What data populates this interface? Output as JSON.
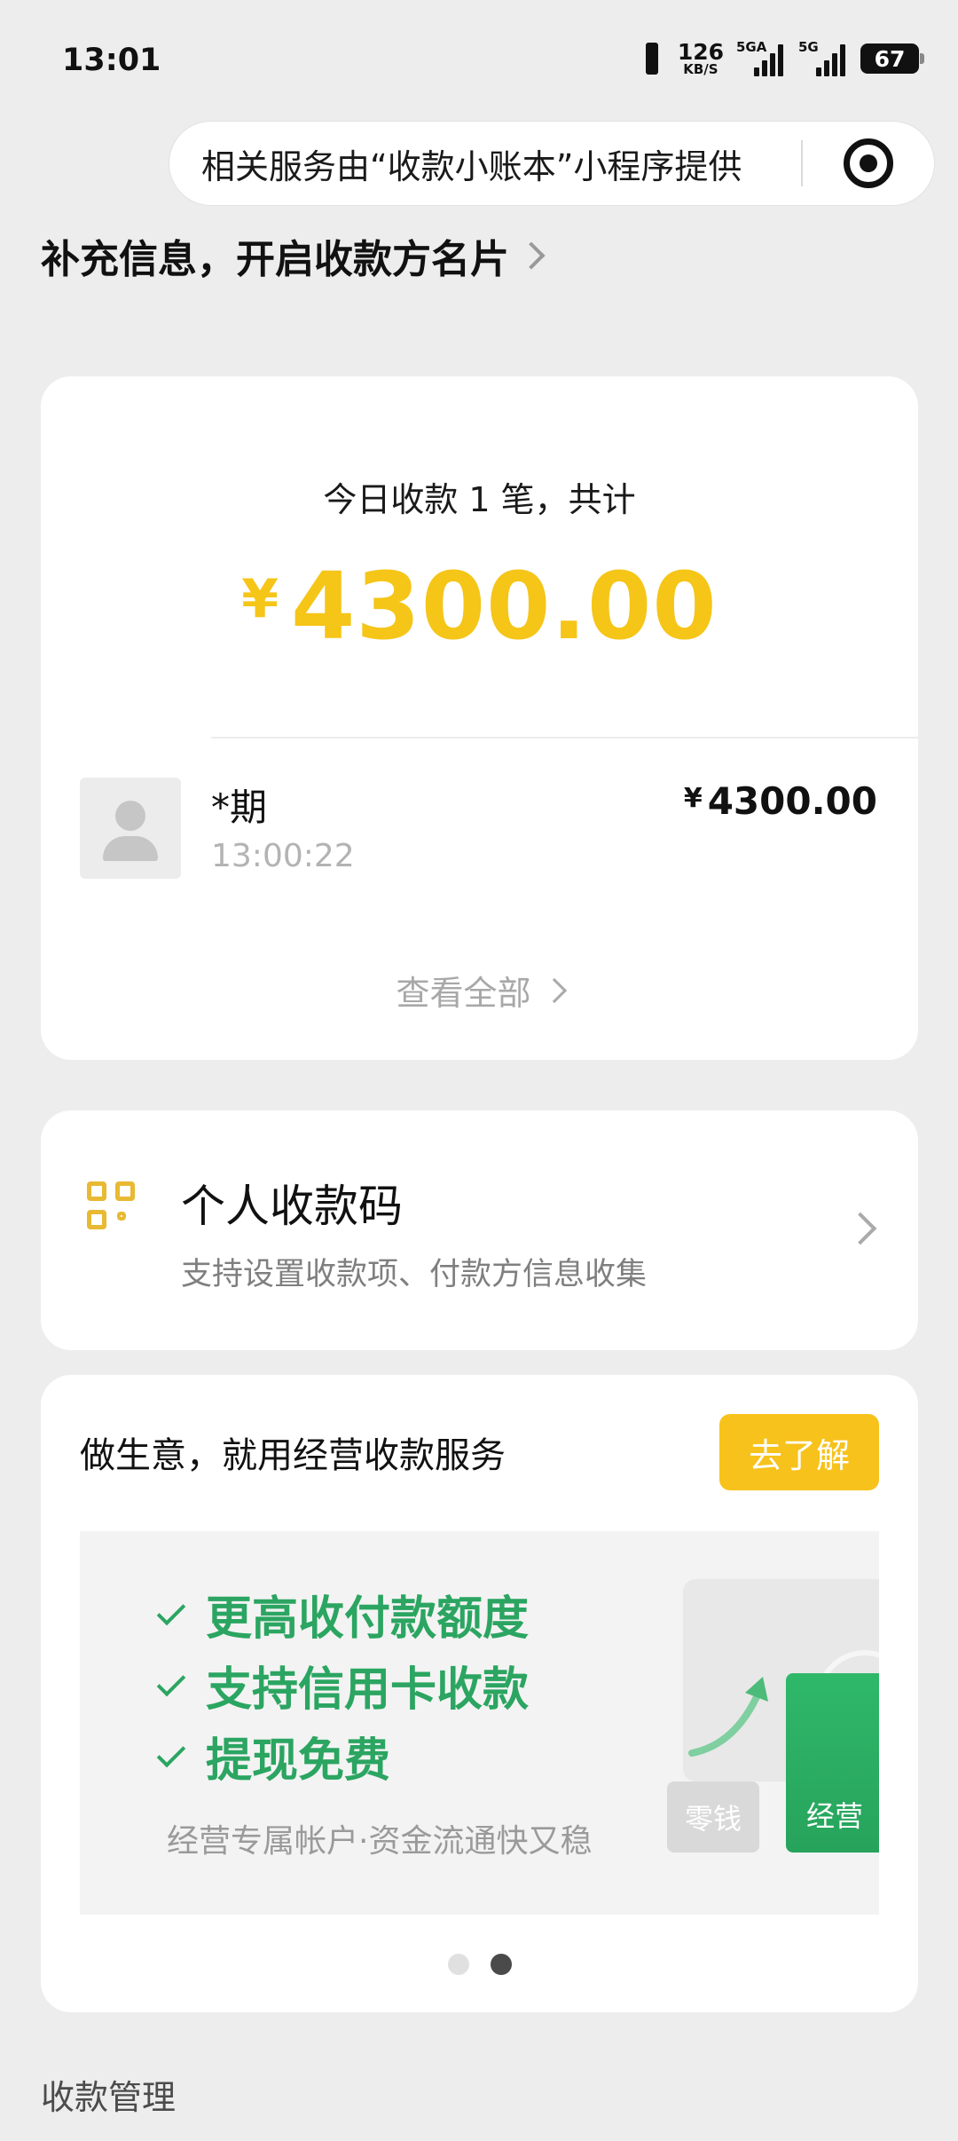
{
  "status_bar": {
    "time": "13:01",
    "net_speed_value": "126",
    "net_speed_unit": "KB/S",
    "signal1_label": "5GA",
    "signal2_label": "5G",
    "battery": "67"
  },
  "capsule": {
    "text": "相关服务由“收款小账本”小程序提供"
  },
  "profile_link": {
    "label": "补充信息，开启收款方名片"
  },
  "today": {
    "summary": "今日收款 1 笔，共计",
    "currency": "¥",
    "total": "4300.00",
    "records": [
      {
        "name": "*期",
        "time": "13:00:22",
        "currency": "¥",
        "amount": "4300.00"
      }
    ],
    "view_all": "查看全部"
  },
  "personal_code": {
    "title": "个人收款码",
    "subtitle": "支持设置收款项、付款方信息收集"
  },
  "business": {
    "title": "做生意，就用经营收款服务",
    "button": "去了解",
    "features": [
      "更高收付款额度",
      "支持信用卡收款",
      "提现免费"
    ],
    "banner_sub": "经营专属帐户·资金流通快又稳",
    "tag_gray": "零钱",
    "tag_green": "经营",
    "carousel": {
      "count": 2,
      "active": 2
    }
  },
  "section": {
    "management": "收款管理"
  },
  "colors": {
    "accent_yellow": "#f5c518",
    "button_yellow": "#f7c21b",
    "green": "#2ba561",
    "background": "#ededed"
  }
}
